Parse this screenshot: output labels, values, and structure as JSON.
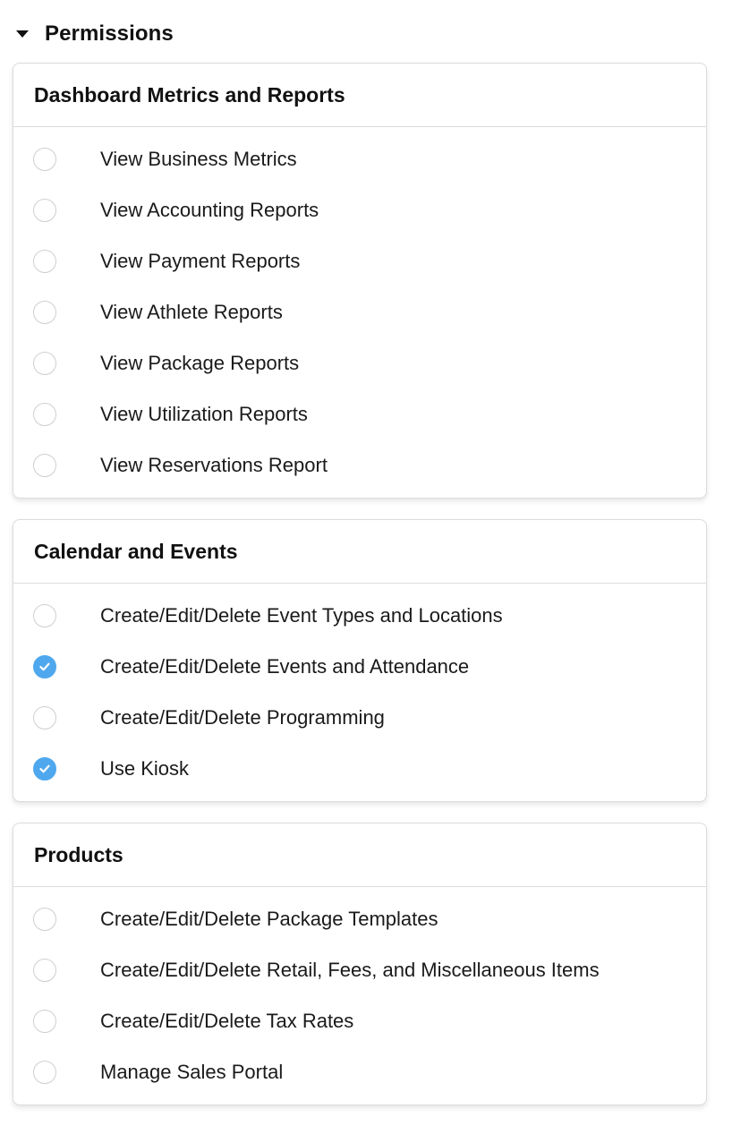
{
  "permissions": {
    "title": "Permissions",
    "groups": [
      {
        "title": "Dashboard Metrics and Reports",
        "items": [
          {
            "label": "View Business Metrics",
            "checked": false
          },
          {
            "label": "View Accounting Reports",
            "checked": false
          },
          {
            "label": "View Payment Reports",
            "checked": false
          },
          {
            "label": "View Athlete Reports",
            "checked": false
          },
          {
            "label": "View Package Reports",
            "checked": false
          },
          {
            "label": "View Utilization Reports",
            "checked": false
          },
          {
            "label": "View Reservations Report",
            "checked": false
          }
        ]
      },
      {
        "title": "Calendar and Events",
        "items": [
          {
            "label": "Create/Edit/Delete Event Types and Locations",
            "checked": false
          },
          {
            "label": "Create/Edit/Delete Events and Attendance",
            "checked": true
          },
          {
            "label": "Create/Edit/Delete Programming",
            "checked": false
          },
          {
            "label": "Use Kiosk",
            "checked": true
          }
        ]
      },
      {
        "title": "Products",
        "items": [
          {
            "label": "Create/Edit/Delete Package Templates",
            "checked": false
          },
          {
            "label": "Create/Edit/Delete Retail, Fees, and Miscellaneous Items",
            "checked": false
          },
          {
            "label": "Create/Edit/Delete Tax Rates",
            "checked": false
          },
          {
            "label": "Manage Sales Portal",
            "checked": false
          }
        ]
      }
    ]
  },
  "colors": {
    "checked_fill": "#4fa8ee",
    "border": "#dcdcdc"
  },
  "icons": {
    "collapse": "caret-down-icon",
    "check": "checkmark-icon"
  }
}
